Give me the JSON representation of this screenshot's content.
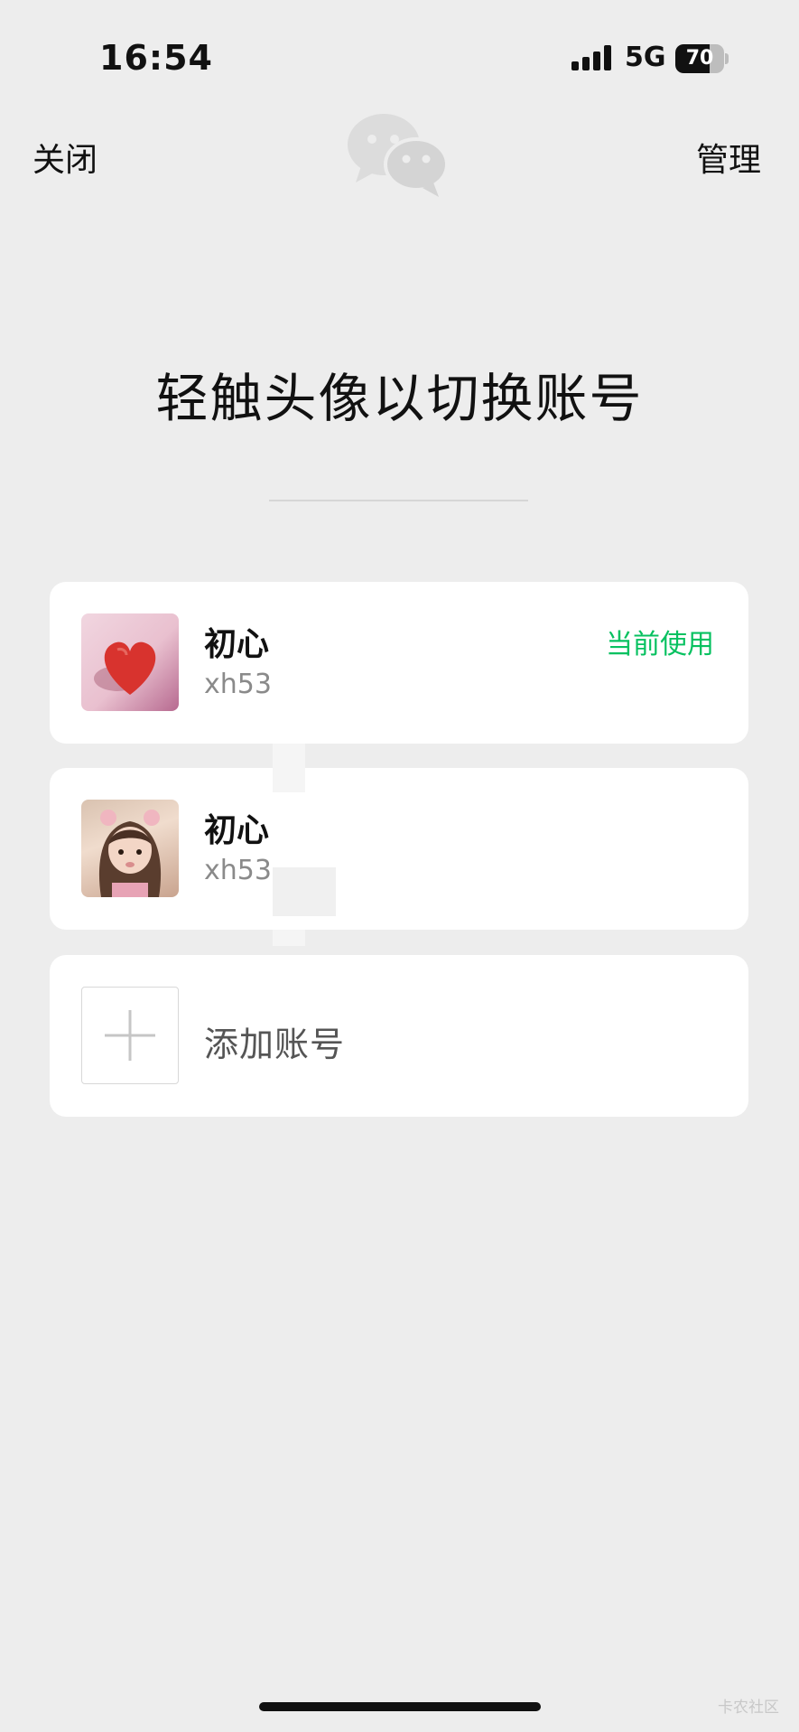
{
  "status_bar": {
    "time": "16:54",
    "network": "5G",
    "battery_level": "70"
  },
  "nav": {
    "close_label": "关闭",
    "manage_label": "管理"
  },
  "title": "轻触头像以切换账号",
  "accounts": [
    {
      "name": "初心",
      "account_id": "xh53",
      "status": "当前使用"
    },
    {
      "name": "初心",
      "account_id": "xh53"
    }
  ],
  "add_account": {
    "label": "添加账号"
  },
  "watermark": "卡农社区",
  "colors": {
    "accent_green": "#07c160",
    "background": "#ededed",
    "card": "#ffffff"
  },
  "icons": {
    "app_logo": "wechat-logo-icon",
    "add": "plus-icon",
    "signal": "cellular-signal-icon",
    "battery": "battery-icon"
  }
}
